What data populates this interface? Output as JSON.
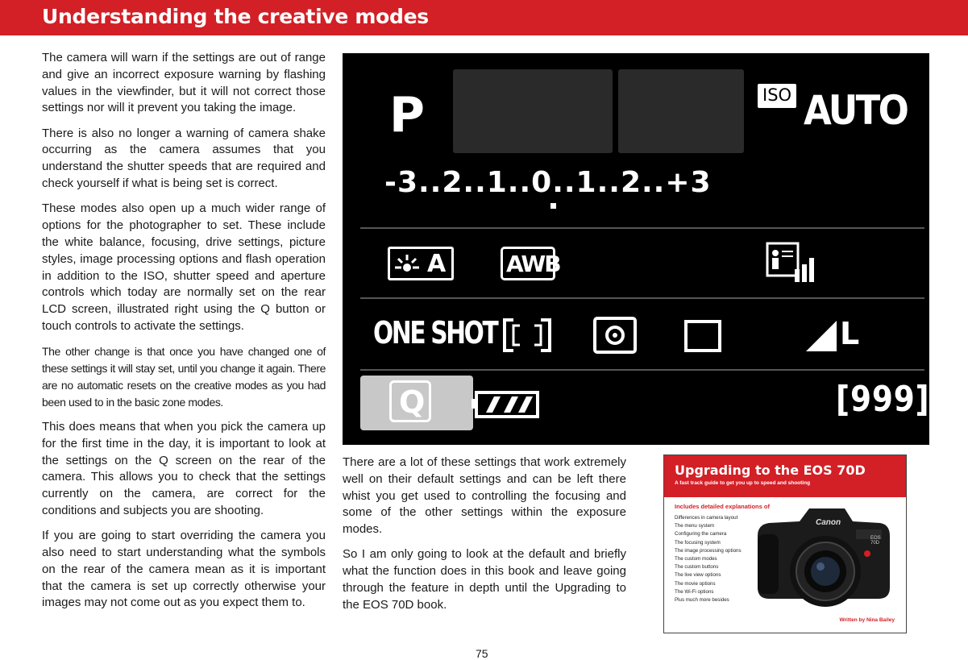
{
  "title": "Understanding the creative modes",
  "left_paragraphs": [
    "The camera will warn if the settings are out of range and give an incorrect exposure warning by flashing values in the viewfinder, but it will not correct those settings nor will it prevent you taking the image.",
    "There is also no longer a warning of camera shake occurring as the camera assumes that you understand the shutter speeds that are required and check yourself if what is being set is correct.",
    "These modes also open up a much wider range of options for the photographer to set. These include the white balance, focusing, drive settings, picture styles, image processing options and flash operation in addition to the ISO, shutter speed and aperture controls which today are normally set on the rear LCD screen, illustrated right using the Q button or touch controls to activate the settings.",
    "The other change is that once you have changed one of these settings it will stay set, until you change it again. There are no automatic resets on the creative modes as you had been used to in the basic zone modes.",
    "This does means that when you pick the camera up for the first time in the day, it is important to look at the settings on the Q screen on the rear of the camera. This allows you to check that the settings currently on the camera, are correct for the conditions and subjects you are shooting.",
    "If you are going to start overriding the camera you also need to start understanding what the symbols on the rear of the camera mean as it is important that the camera is set up correctly otherwise your images may not come out as you expect them to."
  ],
  "lcd": {
    "mode": "P",
    "iso_badge": "ISO",
    "iso_value": "AUTO",
    "exposure_scale": "-3..2..1..0..1..2..+3",
    "drive_label": "ONE SHOT",
    "wb_label": "AWB",
    "q_label": "Q",
    "shots": "[999]",
    "quality": "L",
    "flash_icon_label": "A"
  },
  "middle_paragraphs": [
    "There are a lot of these settings that work extremely well on their default settings and can be left there whist you get used to controlling the focusing and some of the other settings within the exposure modes.",
    "So I am only going to look at the default and briefly what the function does in this book and leave going through the feature in depth until the Upgrading to the EOS 70D book."
  ],
  "book": {
    "title": "Upgrading to the EOS 70D",
    "subtitle": "A fast track guide to get you up to speed and shooting",
    "heading": "Includes detailed explanations of",
    "items": [
      "Differences in camera layout",
      "The menu system",
      "Configuring the camera",
      "The focusing system",
      "The image processing options",
      "The custom modes",
      "The custom buttons",
      "The live view options",
      "The movie options",
      "The Wi-Fi options",
      "Plus much more besides"
    ],
    "author": "Written by Nina Bailey",
    "camera_brand": "Canon",
    "camera_model": "EOS 70D"
  },
  "page_number": "75"
}
